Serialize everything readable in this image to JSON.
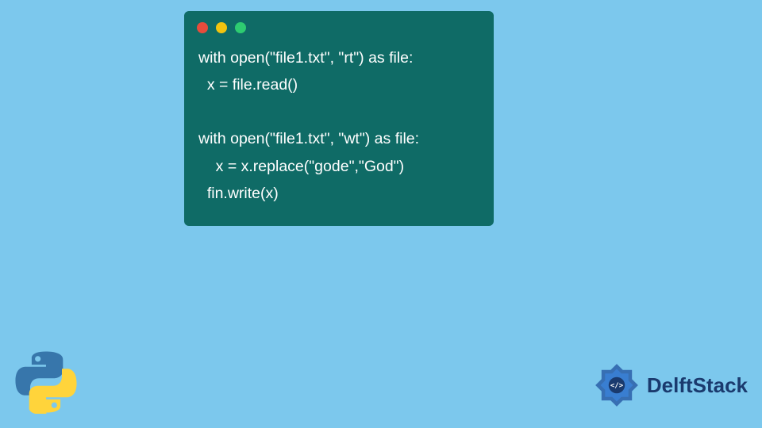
{
  "code": {
    "lines": [
      "with open(\"file1.txt\", \"rt\") as file:",
      "  x = file.read()",
      "  ",
      "with open(\"file1.txt\", \"wt\") as file:",
      "    x = x.replace(\"gode\",\"God\")",
      "  fin.write(x)"
    ]
  },
  "brand": {
    "name": "DelftStack"
  },
  "colors": {
    "background": "#7cc8ed",
    "window": "#0f6b66",
    "brand": "#1a3a6e",
    "dot_red": "#e74c3c",
    "dot_yellow": "#f1c40f",
    "dot_green": "#2ecc71"
  }
}
